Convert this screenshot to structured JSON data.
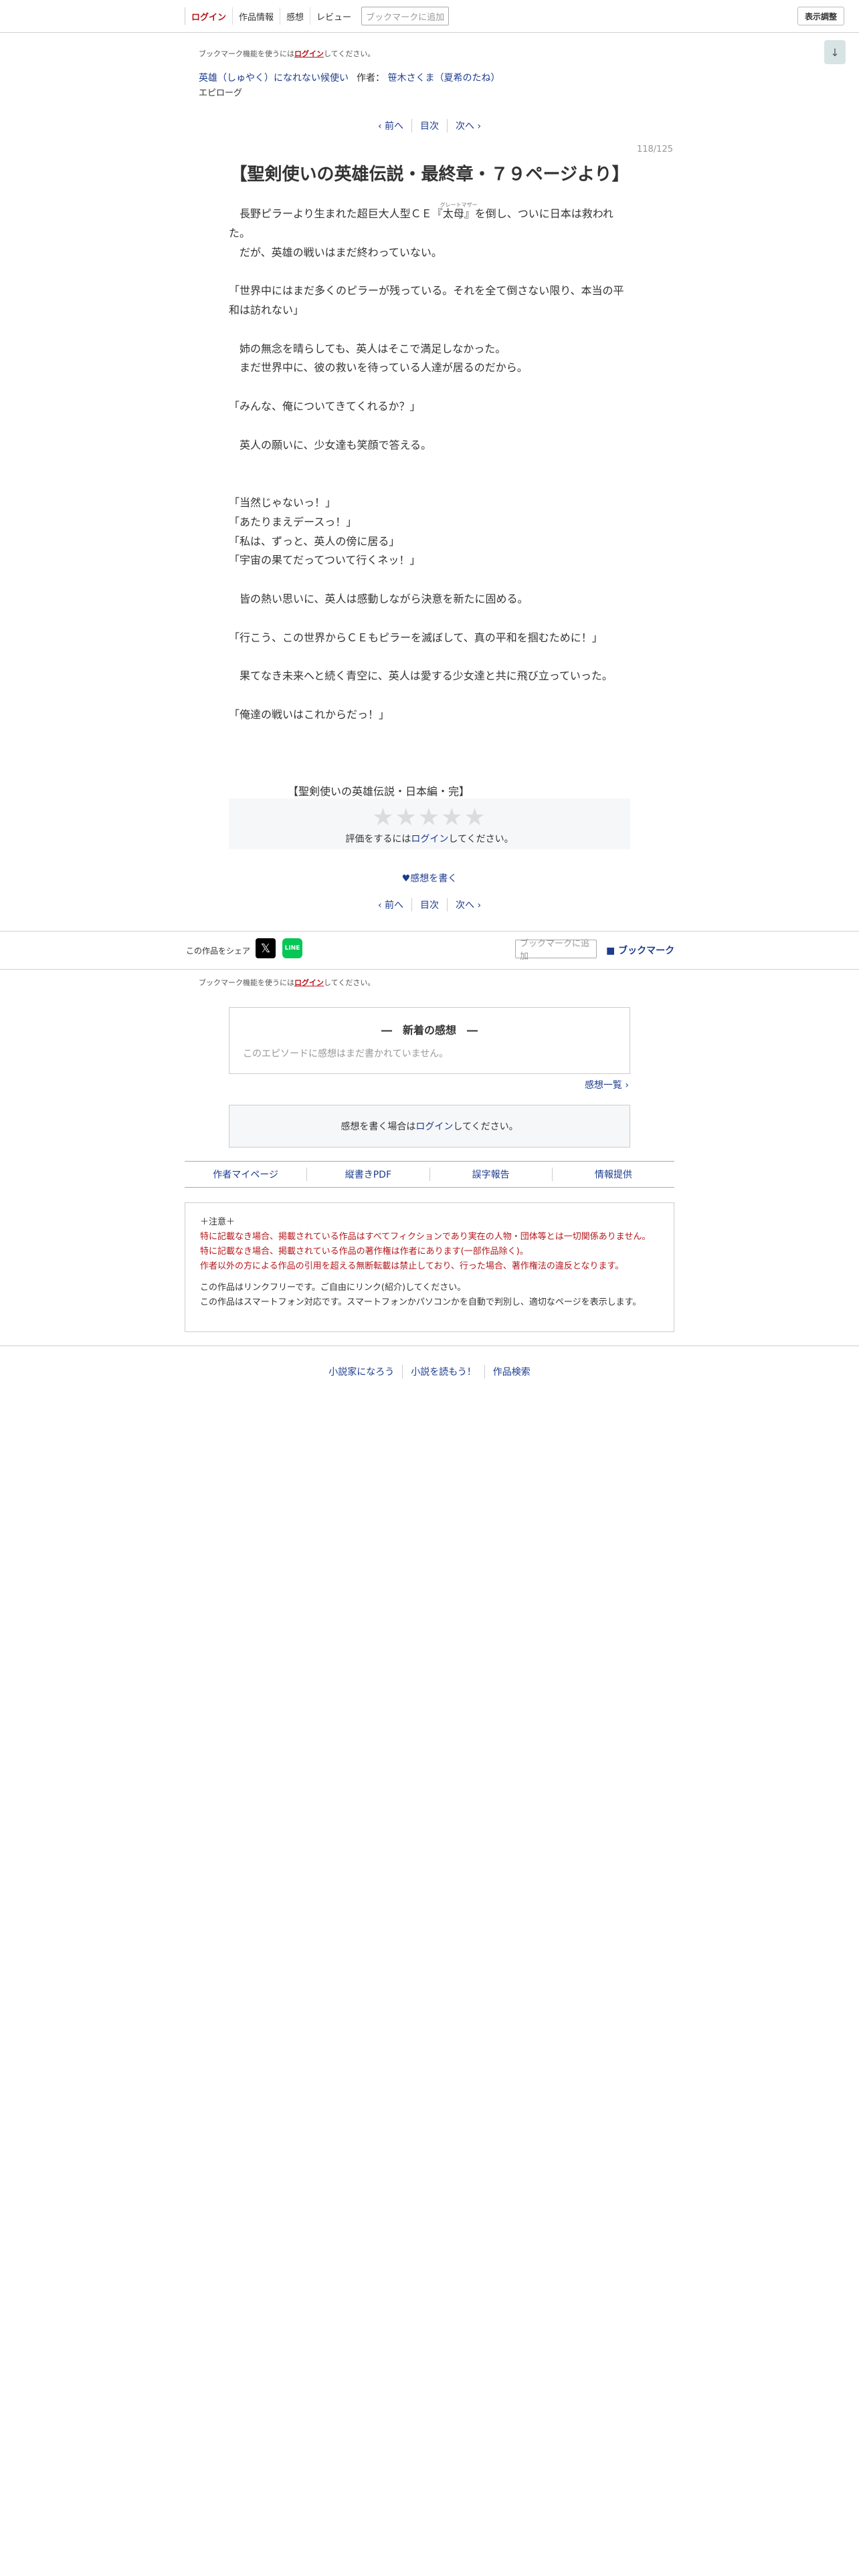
{
  "topbar": {
    "login": "ログイン",
    "work_info": "作品情報",
    "impressions": "感想",
    "review": "レビュー",
    "bookmark_add": "ブックマークに追加",
    "display_settings": "表示調整",
    "scroll_icon": "↓"
  },
  "bookmark_notice": {
    "prefix": "ブックマーク機能を使うには",
    "login": "ログイン",
    "suffix": "してください。"
  },
  "series": {
    "title": "英雄（しゅやく）になれない候使い",
    "author_label": "作者：",
    "author": "笹木さくま（夏希のたね）"
  },
  "episode_label": "エピローグ",
  "pager": {
    "prev": "‹ 前へ",
    "toc": "目次",
    "next": "次へ ›"
  },
  "page_count": "118/125",
  "episode_title": "【聖剣使いの英雄伝説・最終章・７９ページより】",
  "body": {
    "l1a": "　長野ピラーより生まれた超巨大人型ＣＥ『",
    "l1b": "太母",
    "l1b_ruby": "グレートマザー",
    "l1c": "』を倒し、ついに日本は救われ",
    "l2": "た。",
    "l3": "　だが、英雄の戦いはまだ終わっていない。",
    "l4": "",
    "l5": "「世界中にはまだ多くのピラーが残っている。それを全て倒さない限り、本当の平",
    "l6": "和は訪れない」",
    "l7": "",
    "l8": "　姉の無念を晴らしても、英人はそこで満足しなかった。",
    "l9": "　まだ世界中に、彼の救いを待っている人達が居るのだから。",
    "l10": "",
    "l11": "「みんな、俺についてきてくれるか？」",
    "l12": "",
    "l13": "　英人の願いに、少女達も笑顔で答える。",
    "l14": "",
    "l15": "",
    "l16": "「当然じゃないっ！」",
    "l17": "「あたりまえデースっ！」",
    "l18": "「私は、ずっと、英人の傍に居る」",
    "l19": "「宇宙の果てだってついて行くネッ！」",
    "l20": "",
    "l21": "　皆の熱い思いに、英人は感動しながら決意を新たに固める。",
    "l22": "",
    "l23": "「行こう、この世界からＣＥもピラーを滅ぼして、真の平和を掴むために！」",
    "l24": "",
    "l25": "　果てなき未来へと続く青空に、英人は愛する少女達と共に飛び立っていった。",
    "l26": "",
    "l27": "「俺達の戦いはこれからだっ！」",
    "l28": "",
    "l29": "",
    "l30": "",
    "l31": "　　　　　　【聖剣使いの英雄伝説・日本編・完】"
  },
  "rating": {
    "stars": "★★★★★",
    "prefix": "評価をするには",
    "login": "ログイン",
    "suffix": "してください。"
  },
  "write_impression": "♥感想を書く",
  "share": {
    "label": "この作品をシェア",
    "x": "𝕏",
    "line": "LINE",
    "bookmark_add": "ブックマークに追加",
    "bookmark": "ブックマーク"
  },
  "impressions": {
    "title": "―　新着の感想　―",
    "empty": "このエピソードに感想はまだ書かれていません。",
    "list": "感想一覧 ›"
  },
  "login_box": {
    "prefix": "感想を書く場合は",
    "login": "ログイン",
    "suffix": "してください。"
  },
  "footer_nav": {
    "author_page": "作者マイページ",
    "vertical_pdf": "縦書きPDF",
    "typo_report": "誤字報告",
    "info": "情報提供"
  },
  "notice": {
    "heading": "＋注意＋",
    "red1": "特に記載なき場合、掲載されている作品はすべてフィクションであり実在の人物・団体等とは一切関係ありません。",
    "red2": "特に記載なき場合、掲載されている作品の著作権は作者にあります(一部作品除く)。",
    "red3": "作者以外の方による作品の引用を超える無断転載は禁止しており、行った場合、著作権法の違反となります。",
    "line1": "この作品はリンクフリーです。ご自由にリンク(紹介)してください。",
    "line2": "この作品はスマートフォン対応です。スマートフォンかパソコンかを自動で判別し、適切なページを表示します。"
  },
  "footer_links": {
    "narou": "小説家になろう",
    "yomou": "小説を読もう！",
    "search": "作品検索"
  }
}
